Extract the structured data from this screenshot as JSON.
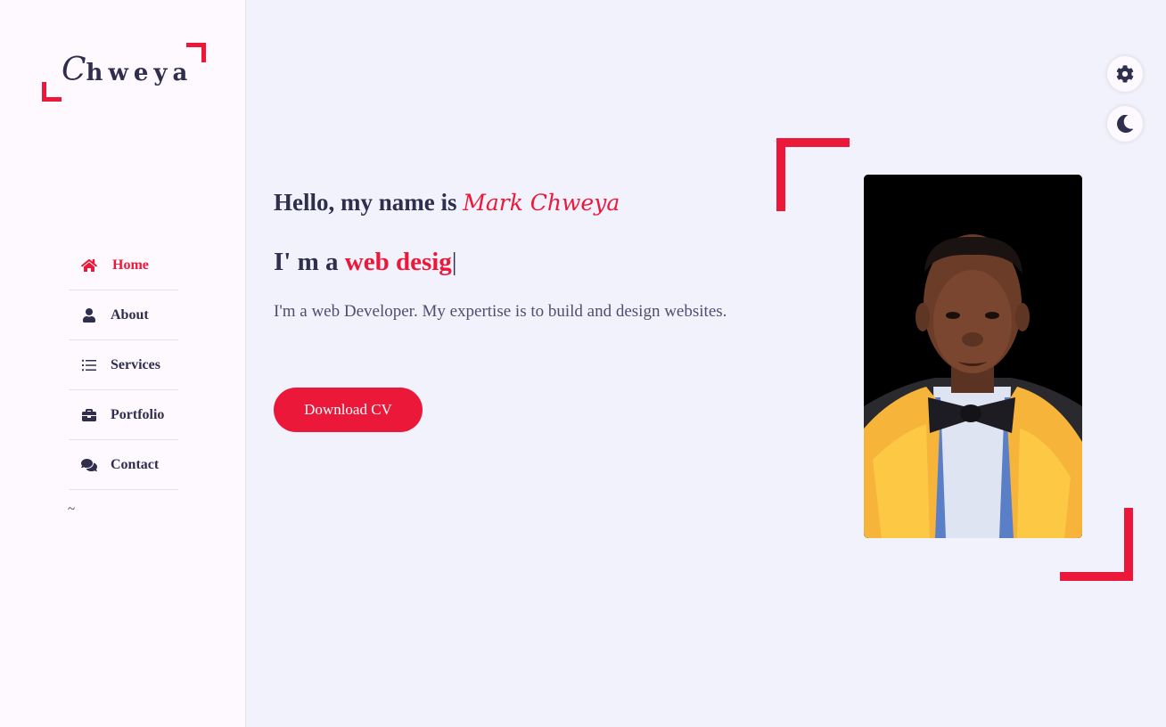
{
  "colors": {
    "accent": "#ec1839",
    "text": "#302e4d",
    "background": "#f2f2fc",
    "sidebar": "#fdf9ff"
  },
  "logo": {
    "first_letter": "C",
    "rest": "hweya"
  },
  "nav": {
    "items": [
      {
        "label": "Home",
        "icon": "home-icon",
        "active": true
      },
      {
        "label": "About",
        "icon": "user-icon",
        "active": false
      },
      {
        "label": "Services",
        "icon": "list-icon",
        "active": false
      },
      {
        "label": "Portfolio",
        "icon": "briefcase-icon",
        "active": false
      },
      {
        "label": "Contact",
        "icon": "comments-icon",
        "active": false
      }
    ],
    "tilde": "~"
  },
  "hero": {
    "greeting": "Hello, my name is ",
    "name": "Mark Chweya",
    "role_prefix": "I' m a ",
    "role_typed": "web desig",
    "cursor": "|",
    "intro": "I'm a web Developer. My expertise is to build and design websites.",
    "download_label": "Download CV"
  },
  "style_switcher": {
    "settings_icon": "gear-icon",
    "theme_icon": "moon-icon"
  }
}
